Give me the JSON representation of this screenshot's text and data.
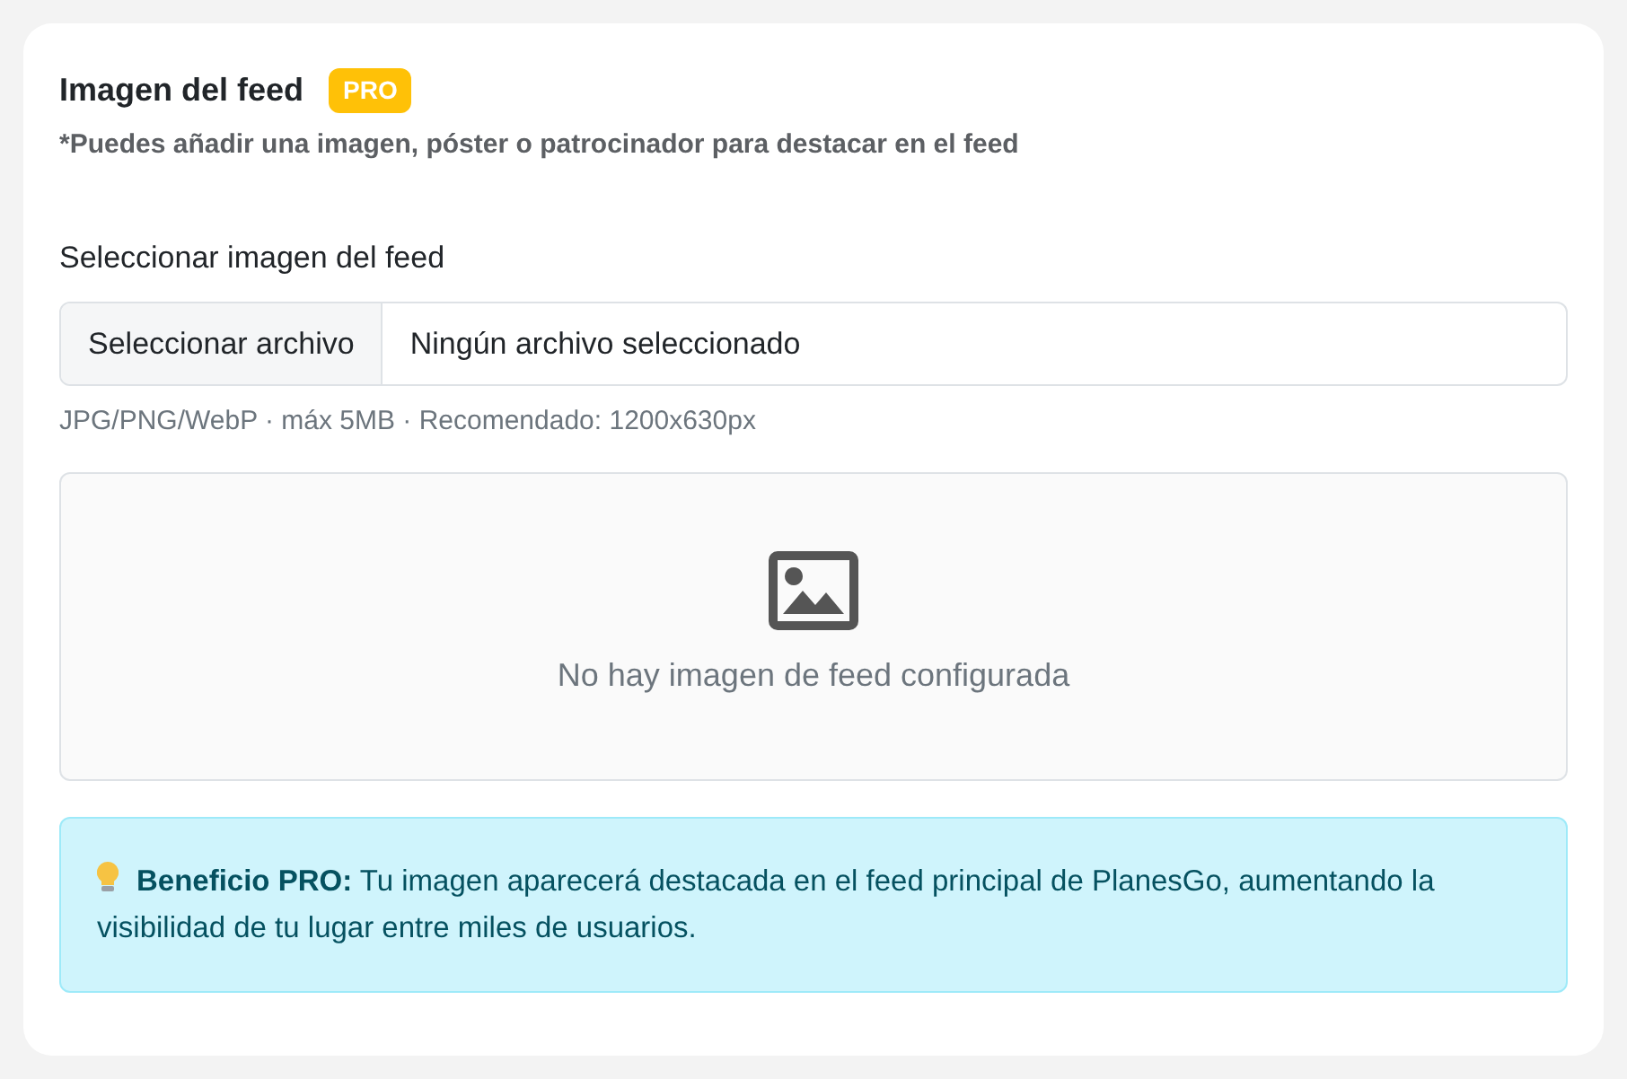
{
  "section": {
    "title": "Imagen del feed",
    "badge": "PRO",
    "subtitle": "*Puedes añadir una imagen, póster o patrocinador para destacar en el feed"
  },
  "file_input": {
    "label": "Seleccionar imagen del feed",
    "button": "Seleccionar archivo",
    "value": "Ningún archivo seleccionado",
    "hint": "JPG/PNG/WebP · máx 5MB · Recomendado: 1200x630px"
  },
  "preview": {
    "empty_text": "No hay imagen de feed configurada"
  },
  "info": {
    "text": "**Beneficio PRO:** Tu imagen aparecerá destacada en el feed principal de PlanesGo, aumentando la visibilidad de tu lugar entre miles de usuarios."
  }
}
